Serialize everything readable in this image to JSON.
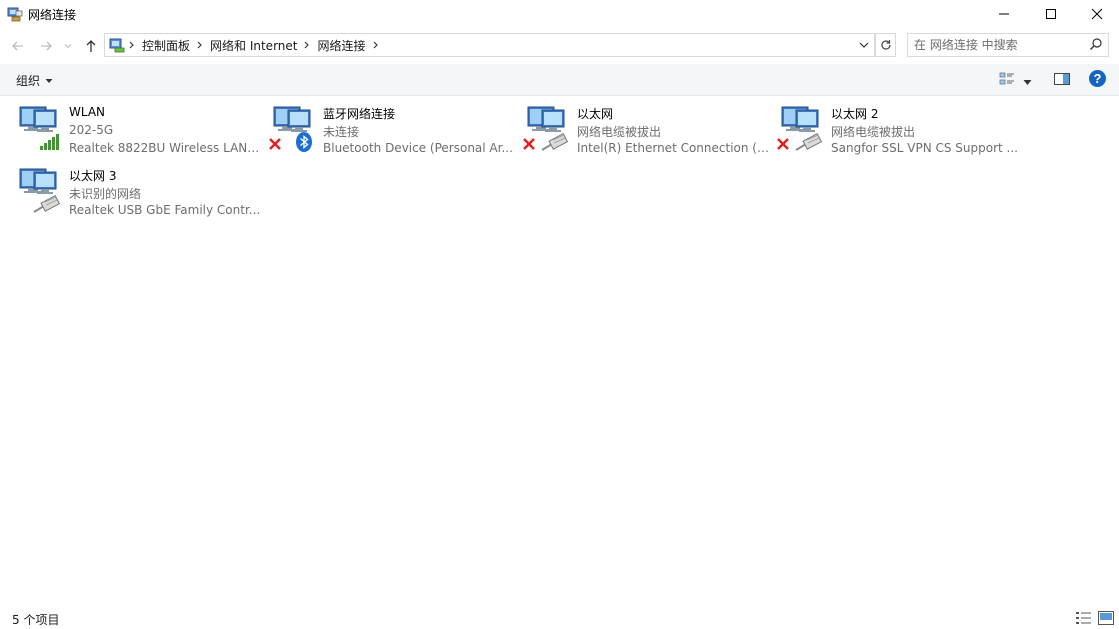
{
  "window": {
    "title": "网络连接",
    "minimize_icon": "minimize-icon",
    "maximize_icon": "maximize-icon",
    "close_icon": "close-icon"
  },
  "breadcrumb": [
    "控制面板",
    "网络和 Internet",
    "网络连接"
  ],
  "search": {
    "placeholder": "在 网络连接 中搜索"
  },
  "toolbar": {
    "organize_label": "组织"
  },
  "connections": [
    {
      "name": "WLAN",
      "status": "202-5G",
      "device": "Realtek 8822BU Wireless LAN ...",
      "icon": "wifi-signal-icon",
      "badge": ""
    },
    {
      "name": "蓝牙网络连接",
      "status": "未连接",
      "device": "Bluetooth Device (Personal Ar...",
      "icon": "bluetooth-icon",
      "badge": "disconnected-x-icon"
    },
    {
      "name": "以太网",
      "status": "网络电缆被拔出",
      "device": "Intel(R) Ethernet Connection (7...",
      "icon": "ethernet-cable-icon",
      "badge": "disconnected-x-icon"
    },
    {
      "name": "以太网 2",
      "status": "网络电缆被拔出",
      "device": "Sangfor SSL VPN CS Support ...",
      "icon": "ethernet-cable-icon",
      "badge": "disconnected-x-icon"
    },
    {
      "name": "以太网 3",
      "status": "未识别的网络",
      "device": "Realtek USB GbE Family Contr...",
      "icon": "ethernet-cable-icon",
      "badge": ""
    }
  ],
  "statusbar": {
    "item_count": "5 个项目"
  },
  "colors": {
    "help_blue": "#1565c0",
    "disconnect_red": "#e02020",
    "signal_green": "#3a9a2a",
    "bluetooth_blue": "#1a6fd6"
  }
}
